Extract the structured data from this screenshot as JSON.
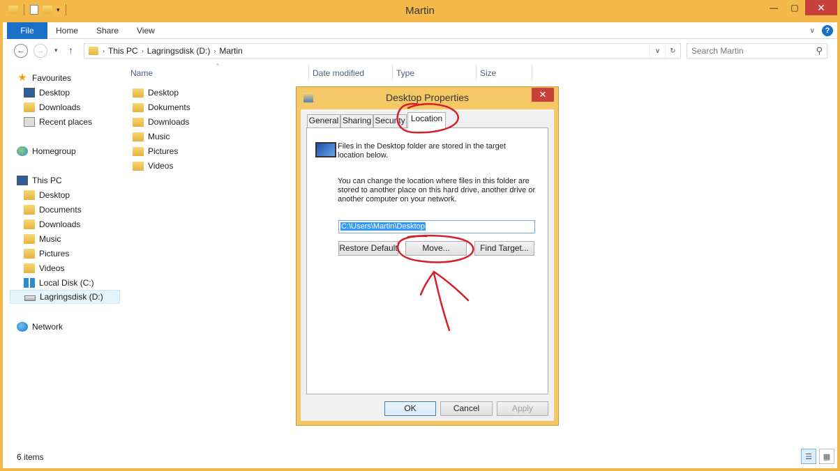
{
  "window": {
    "title": "Martin"
  },
  "ribbon": {
    "tabs": [
      "File",
      "Home",
      "Share",
      "View"
    ]
  },
  "nav": {
    "breadcrumb": [
      "This PC",
      "Lagringsdisk (D:)",
      "Martin"
    ],
    "search_placeholder": "Search Martin"
  },
  "sidebar": {
    "favourites": {
      "label": "Favourites",
      "items": [
        "Desktop",
        "Downloads",
        "Recent places"
      ]
    },
    "homegroup": "Homegroup",
    "this_pc": {
      "label": "This PC",
      "items": [
        "Desktop",
        "Documents",
        "Downloads",
        "Music",
        "Pictures",
        "Videos",
        "Local Disk (C:)",
        "Lagringsdisk (D:)"
      ]
    },
    "network": "Network"
  },
  "columns": [
    "Name",
    "Date modified",
    "Type",
    "Size"
  ],
  "files": [
    "Desktop",
    "Dokuments",
    "Downloads",
    "Music",
    "Pictures",
    "Videos"
  ],
  "status": {
    "items": "6 items"
  },
  "dialog": {
    "title": "Desktop Properties",
    "tabs": [
      "General",
      "Sharing",
      "Security",
      "Location"
    ],
    "info_line1": "Files in the Desktop folder are stored in the target",
    "info_line2": "location below.",
    "change_line1": "You can change the location where files in this folder are",
    "change_line2": "stored to another place on this hard drive, another drive or",
    "change_line3": "another computer on your network.",
    "path": "C:\\Users\\Martin\\Desktop",
    "buttons": {
      "restore": "Restore Default",
      "move": "Move...",
      "find": "Find Target..."
    },
    "footer": {
      "ok": "OK",
      "cancel": "Cancel",
      "apply": "Apply"
    }
  },
  "colors": {
    "accent": "#1a6fc6",
    "frame": "#f4b94a",
    "annotation": "#d4202a"
  }
}
